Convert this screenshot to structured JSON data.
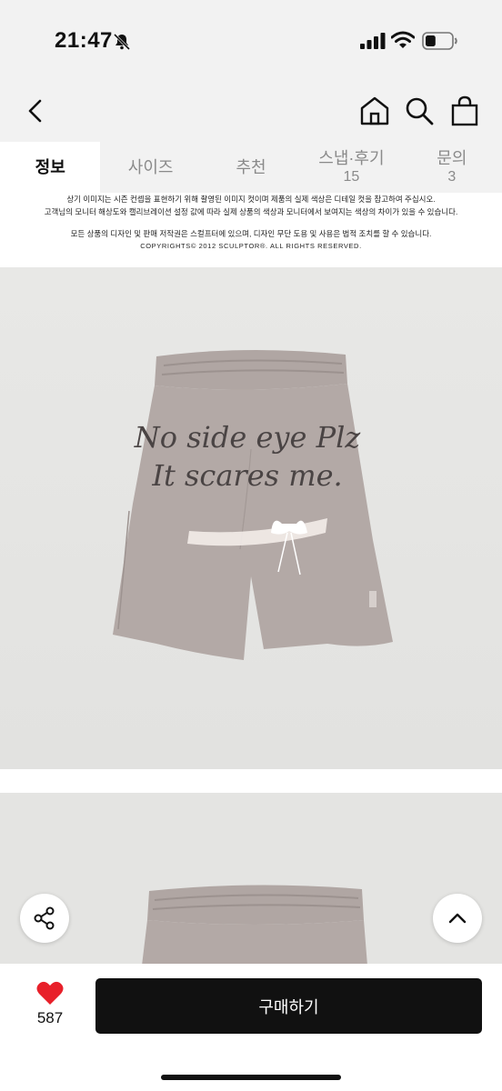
{
  "status_bar": {
    "time": "21:47",
    "battery_level": 0.4
  },
  "tabs": [
    {
      "label": "정보",
      "count": "",
      "active": true
    },
    {
      "label": "사이즈",
      "count": ""
    },
    {
      "label": "추천",
      "count": ""
    },
    {
      "label": "스냅·후기",
      "count": "15"
    },
    {
      "label": "문의",
      "count": "3"
    }
  ],
  "notice": {
    "line1": "상기 이미지는 시즌 컨셉을 표현하기 위해 촬영된 이미지 컷이며 제품의 실제 색상은 디테일 컷을 참고하여 주십시오.",
    "line2": "고객님의 모니터 해상도와 캘리브레이션 설정 값에 따라 실제 상품의 색상과 모니터에서 보여지는 색상의 차이가 있을 수 있습니다.",
    "line3": "모든 상품의 디자인 및 판매 저작권은 스컬프터에 있으며, 디자인 무단 도용 및 사용은 법적 조치를 할 수 있습니다.",
    "copyright": "COPYRIGHTS© 2012 SCULPTOR®. ALL RIGHTS RESERVED."
  },
  "product_print": {
    "line1": "No side eye Plz",
    "line2": "It scares me."
  },
  "bottom": {
    "like_count": "587",
    "buy_label": "구매하기"
  },
  "colors": {
    "accent": "#e8202a",
    "buy_button": "#111111"
  },
  "icons": [
    "back-icon",
    "home-icon",
    "search-icon",
    "bag-icon",
    "share-icon",
    "chevron-up-icon",
    "heart-icon"
  ]
}
